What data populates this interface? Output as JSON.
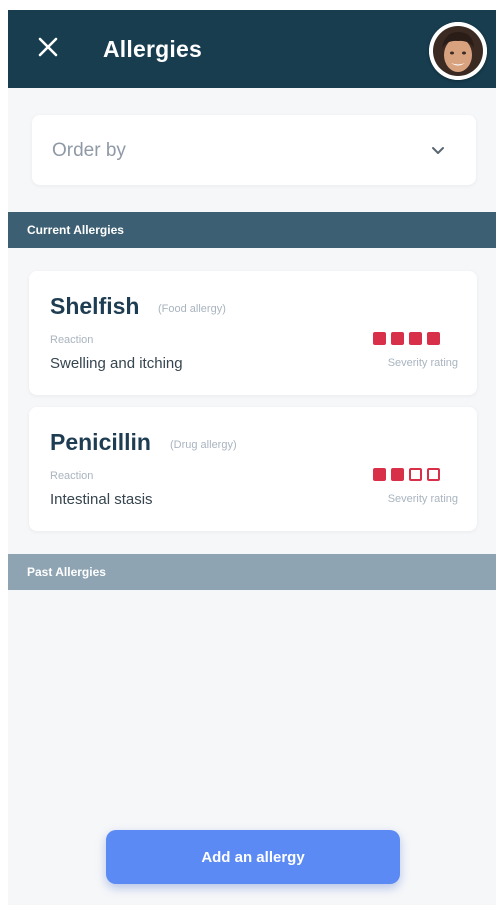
{
  "header": {
    "title": "Allergies",
    "close_icon": "close-icon",
    "background_color": "#173d4f"
  },
  "order_by": {
    "label": "Order by",
    "icon": "chevron-down-icon"
  },
  "sections": {
    "current": {
      "label": "Current Allergies",
      "color": "#3d5f73"
    },
    "past": {
      "label": "Past Allergies",
      "color": "#8ea4b2"
    }
  },
  "allergies": [
    {
      "name": "Shelfish",
      "type": "(Food allergy)",
      "reaction_label": "Reaction",
      "reaction": "Swelling and itching",
      "severity_label": "Severity rating",
      "severity": 4,
      "severity_max": 4
    },
    {
      "name": "Penicillin",
      "type": "(Drug allergy)",
      "reaction_label": "Reaction",
      "reaction": "Intestinal stasis",
      "severity_label": "Severity rating",
      "severity": 2,
      "severity_max": 4
    }
  ],
  "colors": {
    "severity": "#d9304a",
    "primary_button": "#5b8af5"
  },
  "add_button": {
    "label": "Add an allergy"
  }
}
